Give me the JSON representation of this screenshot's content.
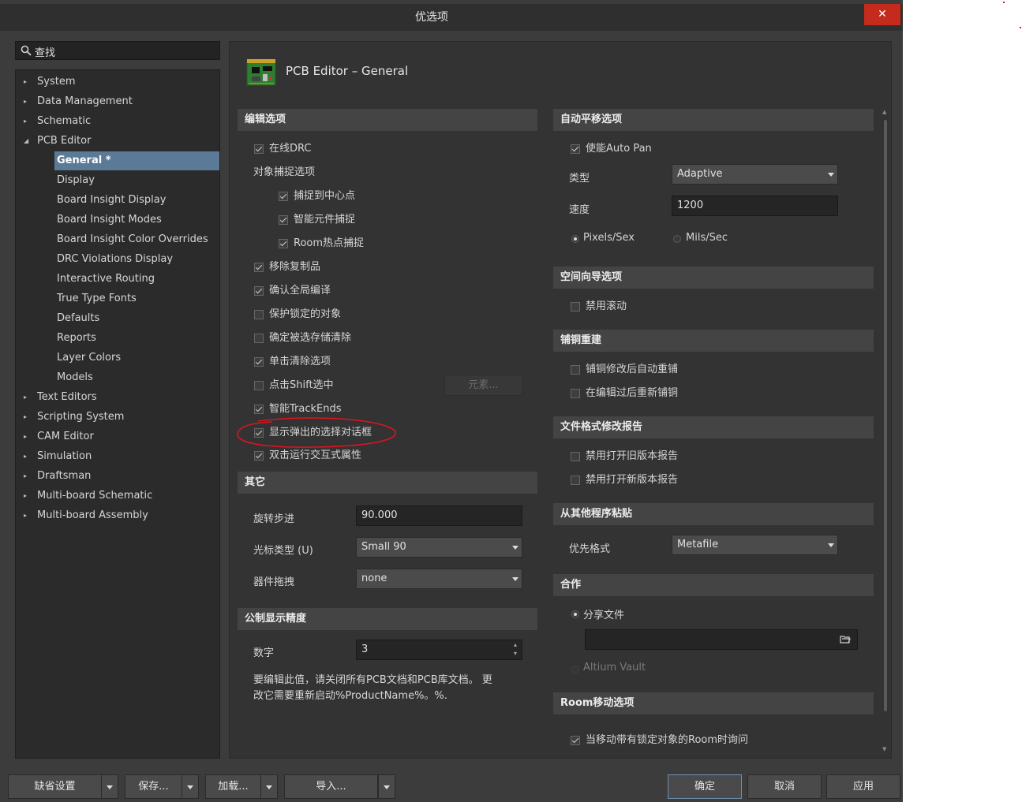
{
  "window": {
    "title": "优选项",
    "close_symbol": "✕"
  },
  "search": {
    "text": "查找"
  },
  "tree": {
    "items": [
      {
        "label": "System",
        "expanded": false
      },
      {
        "label": "Data Management",
        "expanded": false
      },
      {
        "label": "Schematic",
        "expanded": false
      },
      {
        "label": "PCB Editor",
        "expanded": true
      },
      {
        "label": "Text Editors",
        "expanded": false
      },
      {
        "label": "Scripting System",
        "expanded": false
      },
      {
        "label": "CAM Editor",
        "expanded": false
      },
      {
        "label": "Simulation",
        "expanded": false
      },
      {
        "label": "Draftsman",
        "expanded": false
      },
      {
        "label": "Multi-board Schematic",
        "expanded": false
      },
      {
        "label": "Multi-board Assembly",
        "expanded": false
      }
    ],
    "pcb_children": [
      "General *",
      "Display",
      "Board Insight Display",
      "Board Insight Modes",
      "Board Insight Color Overrides",
      "DRC Violations Display",
      "Interactive Routing",
      "True Type Fonts",
      "Defaults",
      "Reports",
      "Layer Colors",
      "Models"
    ],
    "selected_child": "General *",
    "arrow_collapsed": "▸",
    "arrow_expanded": "◢"
  },
  "page": {
    "title": "PCB Editor – General"
  },
  "editing": {
    "header": "编辑选项",
    "online_drc": "在线DRC",
    "snap_label": "对象捕捉选项",
    "snap_center": "捕捉到中心点",
    "smart_component_snap": "智能元件捕捉",
    "room_hotspot_snap": "Room热点捕捉",
    "remove_duplicates": "移除复制品",
    "confirm_global_edit": "确认全局编译",
    "protect_locked": "保护锁定的对象",
    "confirm_selection_memory_clear": "确定被选存储清除",
    "click_clears_selection": "单击清除选项",
    "shift_click_select": "点击Shift选中",
    "primitives_button": "元素...",
    "smart_track_ends": "智能TrackEnds",
    "show_popup_selection_dialog": "显示弹出的选择对话框",
    "double_click_inspector": "双击运行交互式属性"
  },
  "other": {
    "header": "其它",
    "rotation_step_label": "旋转步进",
    "rotation_step_value": "90.000",
    "cursor_type_label": "光标类型 (U)",
    "cursor_type_value": "Small 90",
    "component_drag_label": "器件拖拽",
    "component_drag_value": "none"
  },
  "metric": {
    "header": "公制显示精度",
    "digits_label": "数字",
    "digits_value": "3",
    "note_line1": "要编辑此值，请关闭所有PCB文档和PCB库文档。 更",
    "note_line2": "改它需要重新启动%ProductName%。%."
  },
  "autopan": {
    "header": "自动平移选项",
    "enable": "使能Auto Pan",
    "type_label": "类型",
    "type_value": "Adaptive",
    "speed_label": "速度",
    "speed_value": "1200",
    "pixels_sec": "Pixels/Sex",
    "mils_sec": "Mils/Sec"
  },
  "space_nav": {
    "header": "空间向导选项",
    "disable_roll": "禁用滚动"
  },
  "polygon": {
    "header": "铺铜重建",
    "repour_after_modify": "铺铜修改后自动重铺",
    "repour_after_edit": "在编辑过后重新铺铜"
  },
  "file_format": {
    "header": "文件格式修改报告",
    "disable_old": "禁用打开旧版本报告",
    "disable_new": "禁用打开新版本报告"
  },
  "paste": {
    "header": "从其他程序粘贴",
    "preferred_label": "优先格式",
    "preferred_value": "Metafile"
  },
  "collab": {
    "header": "合作",
    "share_file": "分享文件",
    "share_path": "",
    "vault": "Altium Vault"
  },
  "room_move": {
    "header": "Room移动选项",
    "ask_locked": "当移动带有锁定对象的Room时询问"
  },
  "buttons": {
    "defaults": "缺省设置",
    "save": "保存...",
    "load": "加载...",
    "import": "导入...",
    "ok": "确定",
    "cancel": "取消",
    "apply": "应用"
  },
  "colors": {
    "selection": "#5b7a98",
    "annotation": "#e0141e",
    "close": "#c42b1c"
  }
}
